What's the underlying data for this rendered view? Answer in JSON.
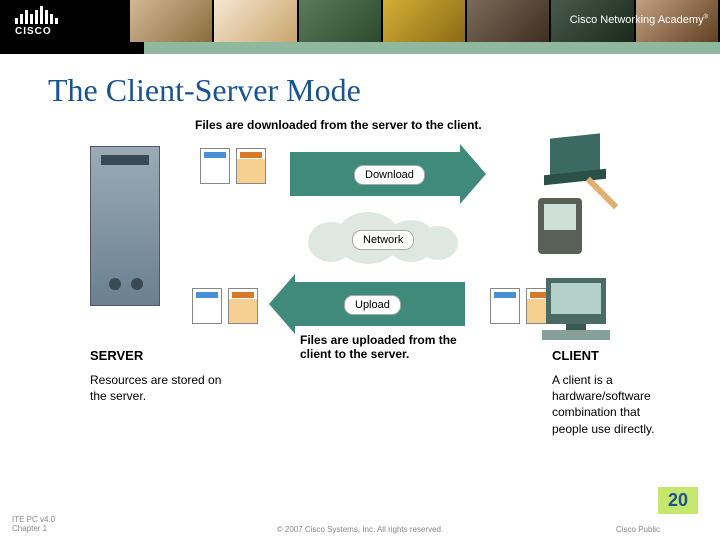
{
  "header": {
    "logo_text": "CISCO",
    "academy_text": "Cisco Networking Academy",
    "academy_mark": "®"
  },
  "slide": {
    "title": "The Client-Server Mode",
    "top_caption": "Files are downloaded from the server to the client.",
    "download_label": "Download",
    "network_label": "Network",
    "upload_label": "Upload",
    "bottom_caption": "Files are uploaded from the client to the server.",
    "server_label": "SERVER",
    "server_desc": "Resources are stored on the server.",
    "client_label": "CLIENT",
    "client_desc": "A client is a hardware/software combination that people use directly.",
    "page_number": "20"
  },
  "footer": {
    "left_line1": "ITE PC v4.0",
    "left_line2": "Chapter 1",
    "copyright": "© 2007 Cisco Systems, Inc. All rights reserved.",
    "right": "Cisco Public"
  }
}
